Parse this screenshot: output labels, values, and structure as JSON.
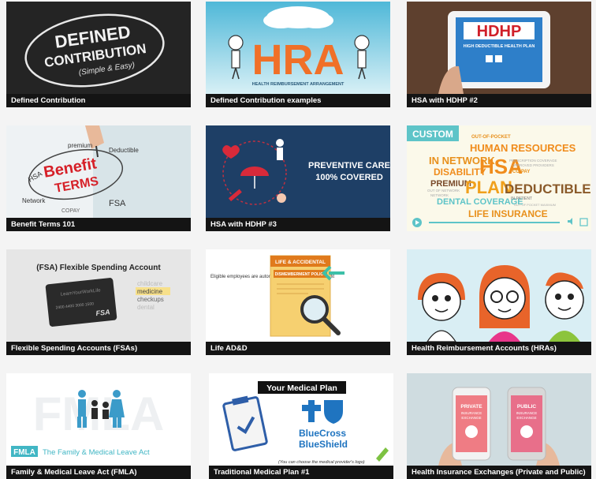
{
  "videos": [
    {
      "caption": "Defined Contribution",
      "art": {
        "line1": "DEFINED",
        "line2": "CONTRIBUTION",
        "line3": "(Simple & Easy)"
      }
    },
    {
      "caption": "Defined Contribution examples",
      "art": {
        "title": "HRA",
        "subtitle": "HEALTH REIMBURSEMENT ARRANGEMENT"
      }
    },
    {
      "caption": "HSA with HDHP #2",
      "art": {
        "title": "HDHP",
        "subtitle": "HIGH DEDUCTIBLE HEALTH PLAN"
      }
    },
    {
      "caption": "Benefit Terms 101",
      "art": {
        "word1": "Benefit",
        "word2": "TERMS",
        "hsa": "HSA",
        "premium": "premium",
        "deductible": "Deductible",
        "fsa": "FSA",
        "network": "Network",
        "copay": "COPAY"
      }
    },
    {
      "caption": "HSA with HDHP #3",
      "art": {
        "line1": "PREVENTIVE CARE",
        "line2": "100% COVERED"
      }
    },
    {
      "caption": "",
      "art": {
        "badge": "CUSTOM",
        "words": [
          "OUT-OF-POCKET",
          "HUMAN RESOURCES",
          "IN NETWORK",
          "HSA",
          "DISABILITY",
          "PREMIUM",
          "PLAN",
          "DEDUCTIBLES",
          "DENTAL COVERAGE",
          "LIFE INSURANCE",
          "CO-PAY",
          "IN-PATIENT",
          "OUT OF NETWORK",
          "PRESCRIPTION COVERAGE",
          "APPROVED PROVIDERS",
          "NETWORK",
          "OUT OF POCKET MAXIMUM"
        ]
      }
    },
    {
      "caption": "Flexible Spending Accounts (FSAs)",
      "art": {
        "title": "(FSA) Flexible Spending Account",
        "card": "LearnYourWorkLife",
        "cardnum": "2400 4400 3000 1500",
        "list": [
          "childcare",
          "medicine",
          "checkups",
          "dental"
        ],
        "brand": "FSA"
      }
    },
    {
      "caption": "Life AD&D",
      "art": {
        "text": "Eligible employees are automatically enrolled in this benefit",
        "doc1": "LIFE & ACCIDENTAL",
        "doc2": "DISMEMBERMENT POLICY"
      }
    },
    {
      "caption": "Health Reimbursement Accounts (HRAs)",
      "art": {}
    },
    {
      "caption": "Family & Medical Leave Act (FMLA)",
      "art": {
        "badge": "FMLA",
        "title": "The Family & Medical Leave Act",
        "bg": "FMLA"
      }
    },
    {
      "caption": "Traditional Medical Plan #1",
      "art": {
        "title": "Your Medical Plan",
        "brand1": "BlueCross",
        "brand2": "BlueShield",
        "note": "(You can choose the medical provider's logo)"
      }
    },
    {
      "caption": "Health Insurance Exchanges (Private and Public)",
      "art": {
        "left1": "PRIVATE",
        "left2": "INSURANCE",
        "left3": "EXCHANGE",
        "right1": "PUBLIC",
        "right2": "INSURANCE",
        "right3": "EXCHANGE"
      }
    }
  ]
}
